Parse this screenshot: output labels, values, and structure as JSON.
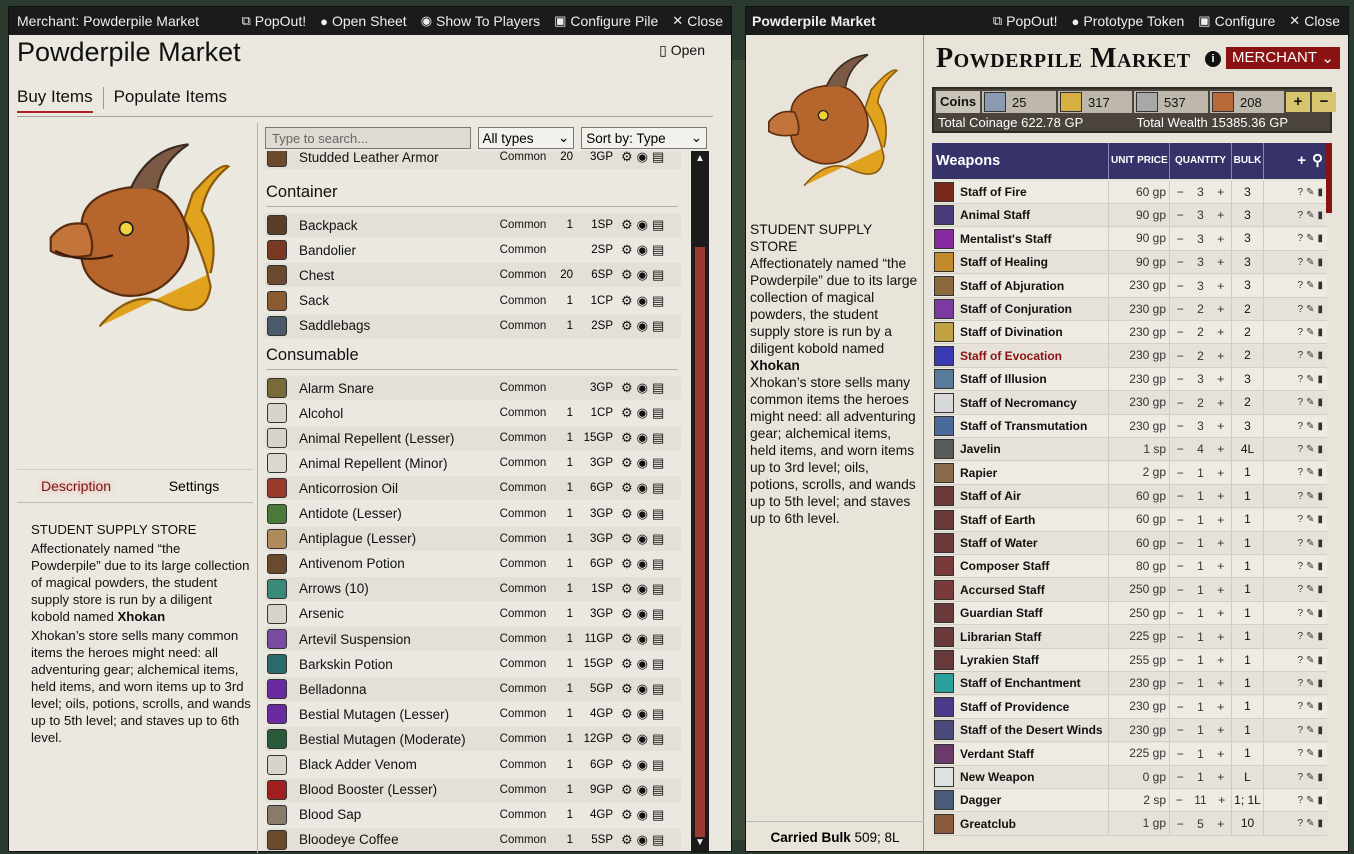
{
  "left": {
    "titlebar": {
      "title": "Merchant: Powderpile Market",
      "popout": "PopOut!",
      "open_sheet": "Open Sheet",
      "show_players": "Show To Players",
      "configure": "Configure Pile",
      "close": "Close"
    },
    "title": "Powderpile Market",
    "open": "Open",
    "tabs": [
      "Buy Items",
      "Populate Items"
    ],
    "desc_tabs": [
      "Description",
      "Settings"
    ],
    "desc": {
      "heading": "STUDENT SUPPLY STORE",
      "p1a": "Affectionately named “the Powderpile” due to its large collection of magical powders, the student supply store is run by a diligent kobold named ",
      "p1b": "Xhokan",
      "p2": "Xhokan’s store sells many common items the heroes might need: all adventuring gear; alchemical items, held items, and worn items up to 3rd level; oils, potions, scrolls, and wands up to 5th level; and staves up to 6th level."
    },
    "filters": {
      "search_placeholder": "Type to search...",
      "type": "All types",
      "sort": "Sort by: Type"
    },
    "partial_row": {
      "name": "Studded Leather Armor",
      "rarity": "Common",
      "qty": "20",
      "price": "3GP"
    },
    "cat1": "Container",
    "container": [
      {
        "name": "Backpack",
        "rarity": "Common",
        "qty": "1",
        "price": "1SP"
      },
      {
        "name": "Bandolier",
        "rarity": "Common",
        "qty": "",
        "price": "2SP"
      },
      {
        "name": "Chest",
        "rarity": "Common",
        "qty": "20",
        "price": "6SP"
      },
      {
        "name": "Sack",
        "rarity": "Common",
        "qty": "1",
        "price": "1CP"
      },
      {
        "name": "Saddlebags",
        "rarity": "Common",
        "qty": "1",
        "price": "2SP"
      }
    ],
    "cat2": "Consumable",
    "consumable": [
      {
        "name": "Alarm Snare",
        "rarity": "Common",
        "qty": "",
        "price": "3GP"
      },
      {
        "name": "Alcohol",
        "rarity": "Common",
        "qty": "1",
        "price": "1CP"
      },
      {
        "name": "Animal Repellent (Lesser)",
        "rarity": "Common",
        "qty": "1",
        "price": "15GP"
      },
      {
        "name": "Animal Repellent (Minor)",
        "rarity": "Common",
        "qty": "1",
        "price": "3GP"
      },
      {
        "name": "Anticorrosion Oil",
        "rarity": "Common",
        "qty": "1",
        "price": "6GP"
      },
      {
        "name": "Antidote (Lesser)",
        "rarity": "Common",
        "qty": "1",
        "price": "3GP"
      },
      {
        "name": "Antiplague (Lesser)",
        "rarity": "Common",
        "qty": "1",
        "price": "3GP"
      },
      {
        "name": "Antivenom Potion",
        "rarity": "Common",
        "qty": "1",
        "price": "6GP"
      },
      {
        "name": "Arrows (10)",
        "rarity": "Common",
        "qty": "1",
        "price": "1SP"
      },
      {
        "name": "Arsenic",
        "rarity": "Common",
        "qty": "1",
        "price": "3GP"
      },
      {
        "name": "Artevil Suspension",
        "rarity": "Common",
        "qty": "1",
        "price": "11GP"
      },
      {
        "name": "Barkskin Potion",
        "rarity": "Common",
        "qty": "1",
        "price": "15GP"
      },
      {
        "name": "Belladonna",
        "rarity": "Common",
        "qty": "1",
        "price": "5GP"
      },
      {
        "name": "Bestial Mutagen (Lesser)",
        "rarity": "Common",
        "qty": "1",
        "price": "4GP"
      },
      {
        "name": "Bestial Mutagen (Moderate)",
        "rarity": "Common",
        "qty": "1",
        "price": "12GP"
      },
      {
        "name": "Black Adder Venom",
        "rarity": "Common",
        "qty": "1",
        "price": "6GP"
      },
      {
        "name": "Blood Booster (Lesser)",
        "rarity": "Common",
        "qty": "1",
        "price": "9GP"
      },
      {
        "name": "Blood Sap",
        "rarity": "Common",
        "qty": "1",
        "price": "4GP"
      },
      {
        "name": "Bloodeye Coffee",
        "rarity": "Common",
        "qty": "1",
        "price": "5SP"
      }
    ]
  },
  "right": {
    "titlebar": {
      "title": "Powderpile Market",
      "popout": "PopOut!",
      "proto": "Prototype Token",
      "configure": "Configure",
      "close": "Close"
    },
    "title": "Powderpile Market",
    "merchant": "MERCHANT",
    "coins": {
      "label": "Coins",
      "pp": "25",
      "gp": "317",
      "sp": "537",
      "cp": "208",
      "total": "Total Coinage 622.78 GP",
      "wealth": "Total Wealth 15385.36 GP"
    },
    "side": {
      "heading": "STUDENT SUPPLY STORE",
      "p1a": "Affectionately named “the Powderpile” due to its large collection of magical powders, the student supply store is run by a diligent kobold named ",
      "p1b": "Xhokan",
      "p2": "Xhokan’s store sells many common items the heroes might need: all adventuring gear; alchemical items, held items, and worn items up to 3rd level; oils, potions, scrolls, and wands up to 5th level; and staves up to 6th level.",
      "bulk_label": "Carried Bulk",
      "bulk_value": "509; 8L"
    },
    "table": {
      "section": "Weapons",
      "unit_price": "UNIT PRICE",
      "quantity": "QUANTITY",
      "bulk": "BULK"
    },
    "items": [
      {
        "name": "Staff of Fire",
        "price": "60 gp",
        "qty": "3",
        "bulk": "3"
      },
      {
        "name": "Animal Staff",
        "price": "90 gp",
        "qty": "3",
        "bulk": "3"
      },
      {
        "name": "Mentalist's Staff",
        "price": "90 gp",
        "qty": "3",
        "bulk": "3"
      },
      {
        "name": "Staff of Healing",
        "price": "90 gp",
        "qty": "3",
        "bulk": "3"
      },
      {
        "name": "Staff of Abjuration",
        "price": "230 gp",
        "qty": "3",
        "bulk": "3"
      },
      {
        "name": "Staff of Conjuration",
        "price": "230 gp",
        "qty": "2",
        "bulk": "2"
      },
      {
        "name": "Staff of Divination",
        "price": "230 gp",
        "qty": "2",
        "bulk": "2"
      },
      {
        "name": "Staff of Evocation",
        "price": "230 gp",
        "qty": "2",
        "bulk": "2"
      },
      {
        "name": "Staff of Illusion",
        "price": "230 gp",
        "qty": "3",
        "bulk": "3"
      },
      {
        "name": "Staff of Necromancy",
        "price": "230 gp",
        "qty": "2",
        "bulk": "2"
      },
      {
        "name": "Staff of Transmutation",
        "price": "230 gp",
        "qty": "3",
        "bulk": "3"
      },
      {
        "name": "Javelin",
        "price": "1 sp",
        "qty": "4",
        "bulk": "4L"
      },
      {
        "name": "Rapier",
        "price": "2 gp",
        "qty": "1",
        "bulk": "1"
      },
      {
        "name": "Staff of Air",
        "price": "60 gp",
        "qty": "1",
        "bulk": "1"
      },
      {
        "name": "Staff of Earth",
        "price": "60 gp",
        "qty": "1",
        "bulk": "1"
      },
      {
        "name": "Staff of Water",
        "price": "60 gp",
        "qty": "1",
        "bulk": "1"
      },
      {
        "name": "Composer Staff",
        "price": "80 gp",
        "qty": "1",
        "bulk": "1"
      },
      {
        "name": "Accursed Staff",
        "price": "250 gp",
        "qty": "1",
        "bulk": "1"
      },
      {
        "name": "Guardian Staff",
        "price": "250 gp",
        "qty": "1",
        "bulk": "1"
      },
      {
        "name": "Librarian Staff",
        "price": "225 gp",
        "qty": "1",
        "bulk": "1"
      },
      {
        "name": "Lyrakien Staff",
        "price": "255 gp",
        "qty": "1",
        "bulk": "1"
      },
      {
        "name": "Staff of Enchantment",
        "price": "230 gp",
        "qty": "1",
        "bulk": "1"
      },
      {
        "name": "Staff of Providence",
        "price": "230 gp",
        "qty": "1",
        "bulk": "1"
      },
      {
        "name": "Staff of the Desert Winds",
        "price": "230 gp",
        "qty": "1",
        "bulk": "1"
      },
      {
        "name": "Verdant Staff",
        "price": "225 gp",
        "qty": "1",
        "bulk": "1"
      },
      {
        "name": "New Weapon",
        "price": "0 gp",
        "qty": "1",
        "bulk": "L"
      },
      {
        "name": "Dagger",
        "price": "2 sp",
        "qty": "11",
        "bulk": "1; 1L"
      },
      {
        "name": "Greatclub",
        "price": "1 gp",
        "qty": "5",
        "bulk": "10"
      }
    ]
  }
}
